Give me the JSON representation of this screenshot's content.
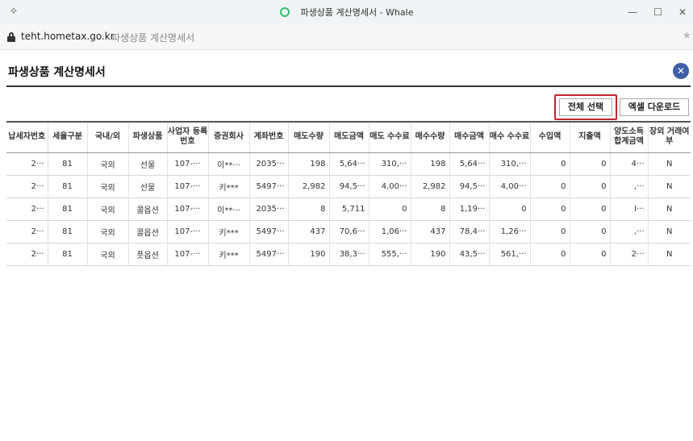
{
  "window": {
    "title": "파생상품 계산명세서 - Whale",
    "pin_icon": "pin-icon",
    "controls": {
      "minimize": "—",
      "maximize": "☐",
      "close": "✕"
    }
  },
  "address_bar": {
    "host": "teht.hometax.go.kr",
    "page_title": "파생상품 계산명세서"
  },
  "dialog": {
    "title": "파생상품 계산명세서",
    "close_icon": "✕",
    "accent_color": "#3e5fa8",
    "highlight_color": "#c0262d",
    "buttons": {
      "select_all": "전체 선택",
      "excel_download": "엑셀 다운로드"
    }
  },
  "table": {
    "headers": [
      "납세자번호",
      "세율구분",
      "국내/외",
      "파생상품",
      "사업자 등록번호",
      "증권회사",
      "계좌번호",
      "매도수량",
      "매도금액",
      "매도 수수료",
      "매수수량",
      "매수금액",
      "매수 수수료",
      "수입액",
      "지출액",
      "양도소득 합계금액",
      "장외 거래여부"
    ],
    "rows": [
      [
        "2···",
        "81",
        "국외",
        "선물",
        "107-···",
        "이**···",
        "2035···",
        "198",
        "5,64···",
        "310,···",
        "198",
        "5,64···",
        "310,···",
        "0",
        "0",
        "4···",
        "N"
      ],
      [
        "2···",
        "81",
        "국외",
        "선물",
        "107-···",
        "키***",
        "5497···",
        "2,982",
        "94,5···",
        "4,00···",
        "2,982",
        "94,5···",
        "4,00···",
        "0",
        "0",
        ",···",
        "N"
      ],
      [
        "2···",
        "81",
        "국외",
        "콜옵션",
        "107-···",
        "이**···",
        "2035···",
        "8",
        "5,711",
        "0",
        "8",
        "1,19···",
        "0",
        "0",
        "0",
        "I···",
        "N"
      ],
      [
        "2···",
        "81",
        "국외",
        "콜옵션",
        "107-···",
        "키***",
        "5497···",
        "437",
        "70,6···",
        "1,06···",
        "437",
        "78,4···",
        "1,26···",
        "0",
        "0",
        ",···",
        "N"
      ],
      [
        "2···",
        "81",
        "국외",
        "풋옵션",
        "107-···",
        "키***",
        "5497···",
        "190",
        "38,3···",
        "555,···",
        "190",
        "43,5···",
        "561,···",
        "0",
        "0",
        "2···",
        "N"
      ]
    ]
  }
}
